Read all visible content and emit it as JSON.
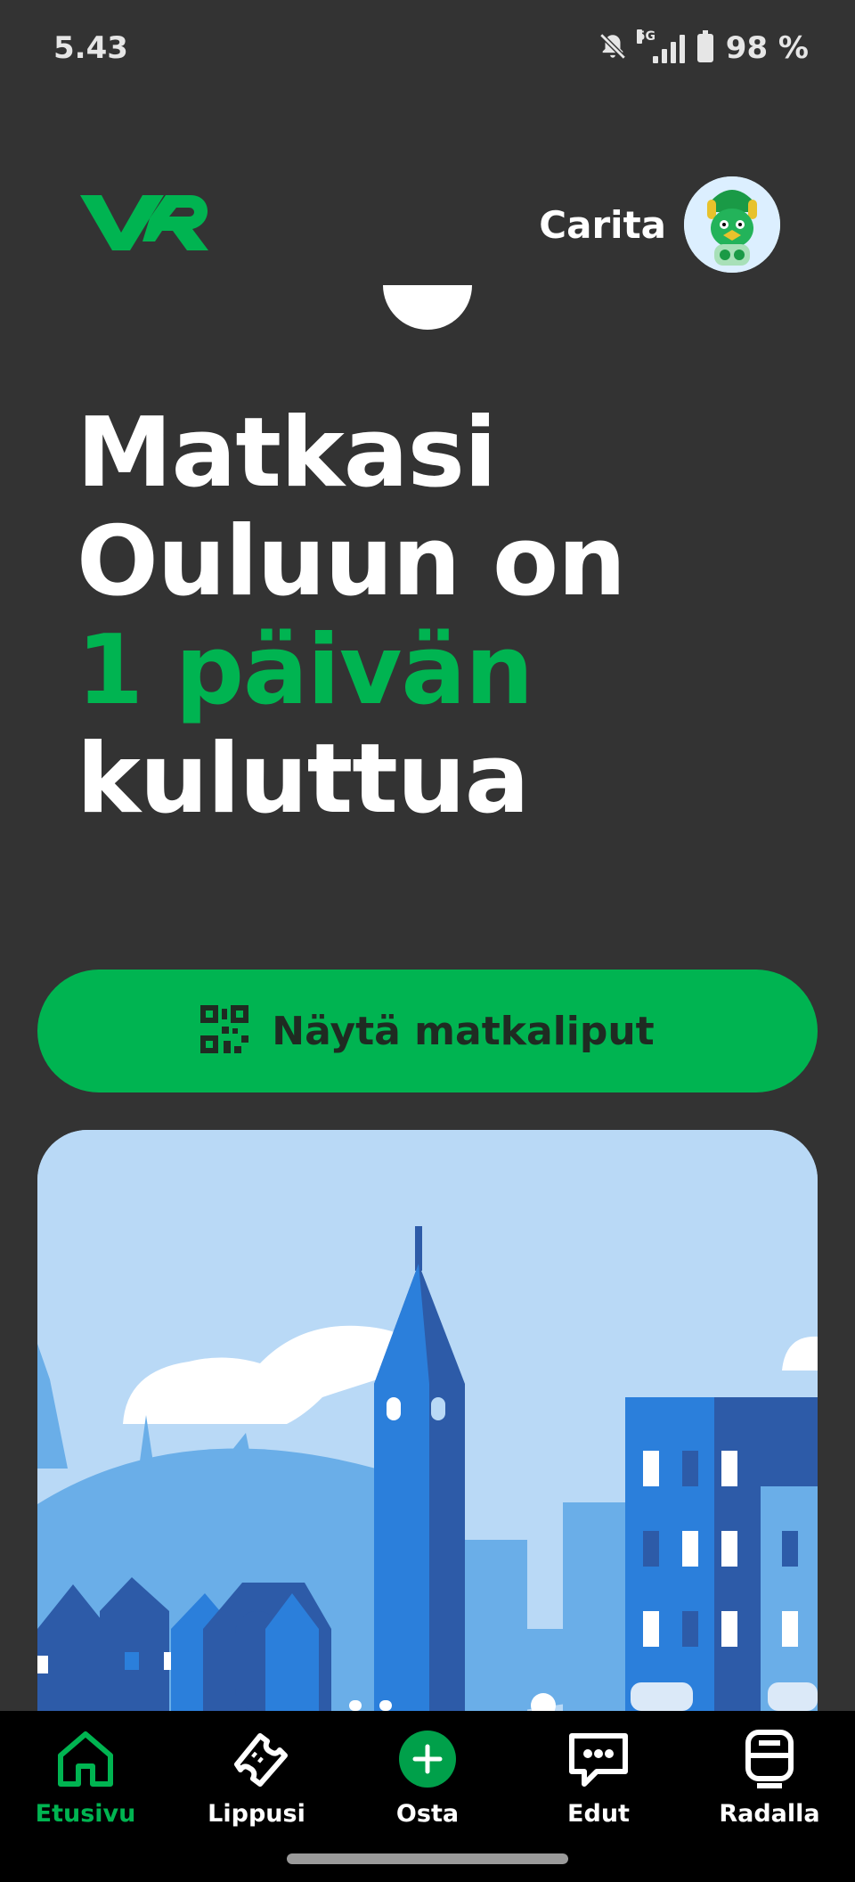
{
  "status_bar": {
    "time": "5.43",
    "network": "5G",
    "battery": "98 %"
  },
  "header": {
    "logo_text": "VR",
    "user_name": "Carita"
  },
  "headline": {
    "line1": "Matkasi",
    "line2": "Ouluun on",
    "line3_highlight": "1 päivän",
    "line4": "kuluttua"
  },
  "primary_button": {
    "label": "Näytä matkaliput",
    "icon": "qr-code-icon"
  },
  "bottom_nav": {
    "items": [
      {
        "label": "Etusivu",
        "icon": "home-icon",
        "active": true
      },
      {
        "label": "Lippusi",
        "icon": "ticket-icon",
        "active": false
      },
      {
        "label": "Osta",
        "icon": "plus-circle-icon",
        "active": false
      },
      {
        "label": "Edut",
        "icon": "chat-bubble-icon",
        "active": false
      },
      {
        "label": "Radalla",
        "icon": "train-icon",
        "active": false
      }
    ]
  },
  "colors": {
    "brand_green": "#00b451",
    "background": "#333333",
    "nav_background": "#000000"
  }
}
